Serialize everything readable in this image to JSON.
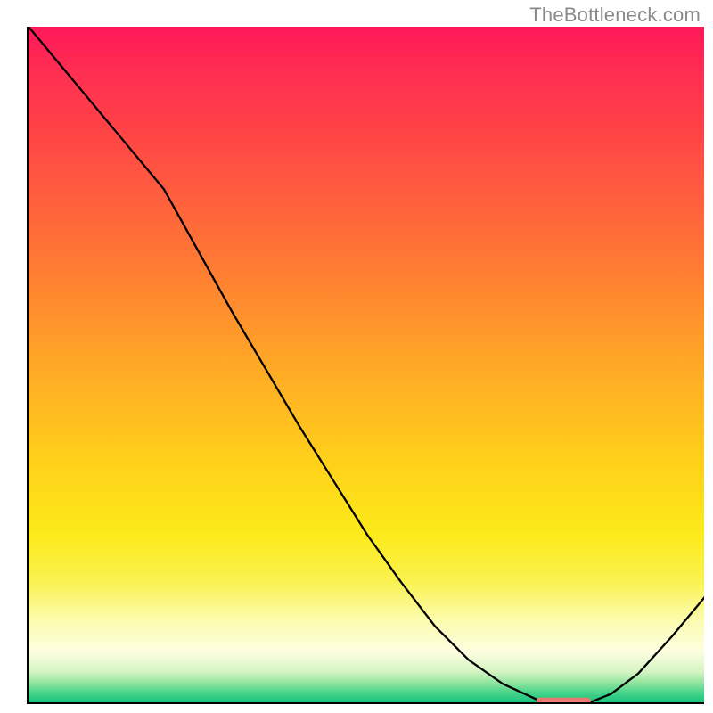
{
  "watermark": "TheBottleneck.com",
  "chart_data": {
    "type": "line",
    "title": "",
    "xlabel": "",
    "ylabel": "",
    "xlim": [
      0,
      100
    ],
    "ylim": [
      0,
      100
    ],
    "series": [
      {
        "name": "curve",
        "x": [
          0,
          5,
          10,
          15,
          20,
          25,
          30,
          35,
          40,
          45,
          50,
          55,
          60,
          65,
          70,
          75,
          78,
          80,
          83,
          86,
          90,
          95,
          100
        ],
        "values": [
          100,
          94,
          88,
          82,
          76,
          67,
          58,
          49.5,
          41,
          33,
          25,
          18,
          11.5,
          6.5,
          3.0,
          0.7,
          0.2,
          0.2,
          0.3,
          1.5,
          4.5,
          10,
          16
        ]
      }
    ],
    "marker": {
      "name": "highlight-segment",
      "x_range": [
        75,
        83
      ],
      "y": 0.5,
      "color": "#e87a72"
    },
    "gradient_stops": [
      {
        "pos": 0.0,
        "color": "#ff1858"
      },
      {
        "pos": 0.07,
        "color": "#ff2f52"
      },
      {
        "pos": 0.15,
        "color": "#ff4246"
      },
      {
        "pos": 0.25,
        "color": "#ff5e3e"
      },
      {
        "pos": 0.35,
        "color": "#ff7a33"
      },
      {
        "pos": 0.5,
        "color": "#ffa826"
      },
      {
        "pos": 0.65,
        "color": "#ffd21a"
      },
      {
        "pos": 0.75,
        "color": "#fcea1a"
      },
      {
        "pos": 0.82,
        "color": "#faf250"
      },
      {
        "pos": 0.88,
        "color": "#fcfcb0"
      },
      {
        "pos": 0.925,
        "color": "#fdfee0"
      },
      {
        "pos": 0.955,
        "color": "#d4f4c2"
      },
      {
        "pos": 0.972,
        "color": "#8de39c"
      },
      {
        "pos": 0.984,
        "color": "#4ed68c"
      },
      {
        "pos": 1.0,
        "color": "#18c37e"
      }
    ]
  }
}
